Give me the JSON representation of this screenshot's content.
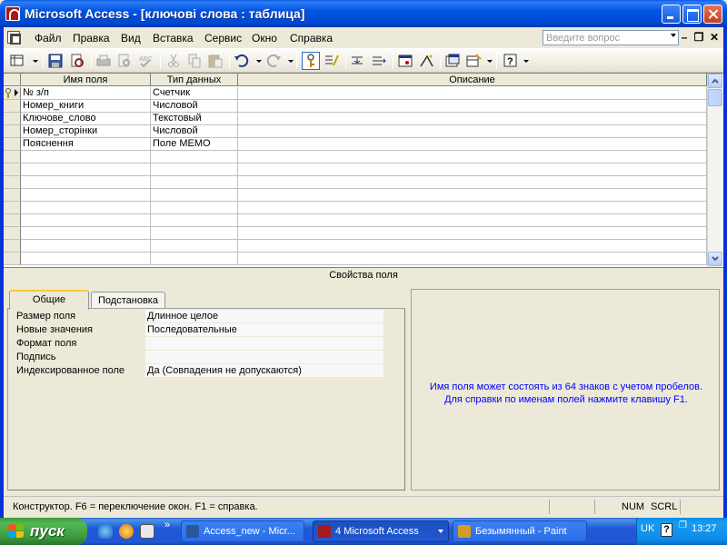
{
  "window": {
    "title": "Microsoft Access - [ключові слова : таблица]"
  },
  "menu": {
    "items": [
      "Файл",
      "Правка",
      "Вид",
      "Вставка",
      "Сервис",
      "Окно",
      "Справка"
    ],
    "help_placeholder": "Введите вопрос"
  },
  "toolbar": {
    "icons": [
      "view-icon",
      "save-icon",
      "print-preview-icon",
      "print-icon",
      "preview-icon",
      "spelling-icon",
      "cut-icon",
      "copy-icon",
      "paste-icon",
      "undo-icon",
      "redo-icon",
      "primary-key-icon",
      "indexes-icon",
      "insert-rows-icon",
      "delete-rows-icon",
      "properties-icon",
      "build-icon",
      "database-window-icon",
      "new-object-icon",
      "help-icon"
    ]
  },
  "grid": {
    "columns": [
      "Имя поля",
      "Тип данных",
      "Описание"
    ],
    "rows": [
      {
        "name": "№ з/п",
        "type": "Счетчик",
        "desc": ""
      },
      {
        "name": "Номер_книги",
        "type": "Числовой",
        "desc": ""
      },
      {
        "name": "Ключове_слово",
        "type": "Текстовый",
        "desc": ""
      },
      {
        "name": "Номер_сторінки",
        "type": "Числовой",
        "desc": ""
      },
      {
        "name": "Пояснення",
        "type": "Поле МЕМО",
        "desc": ""
      }
    ]
  },
  "properties": {
    "title": "Свойства поля",
    "tabs": [
      "Общие",
      "Подстановка"
    ],
    "rows": [
      {
        "label": "Размер поля",
        "value": "Длинное целое"
      },
      {
        "label": "Новые значения",
        "value": "Последовательные"
      },
      {
        "label": "Формат поля",
        "value": ""
      },
      {
        "label": "Подпись",
        "value": ""
      },
      {
        "label": "Индексированное поле",
        "value": "Да (Совпадения не допускаются)"
      }
    ],
    "hint_line1": "Имя поля может состоять из 64 знаков с учетом пробелов.",
    "hint_line2": "Для справки по именам полей нажмите клавишу F1."
  },
  "status": {
    "text": "Конструктор.  F6 = переключение окон.  F1 = справка.",
    "num": "NUM",
    "scrl": "SCRL"
  },
  "taskbar": {
    "start_label": "пуск",
    "tasks": [
      {
        "label": "Access_new - Micr...",
        "active": false
      },
      {
        "label": "4 Microsoft Access",
        "active": true
      },
      {
        "label": "Безымянный - Paint",
        "active": false
      }
    ],
    "lang": "UK",
    "time": "13:27"
  },
  "colors": {
    "titlebar": "#0054e3",
    "hint_text": "#0000ff",
    "taskbar": "#2157d7",
    "start_button": "#3d9b3d"
  }
}
